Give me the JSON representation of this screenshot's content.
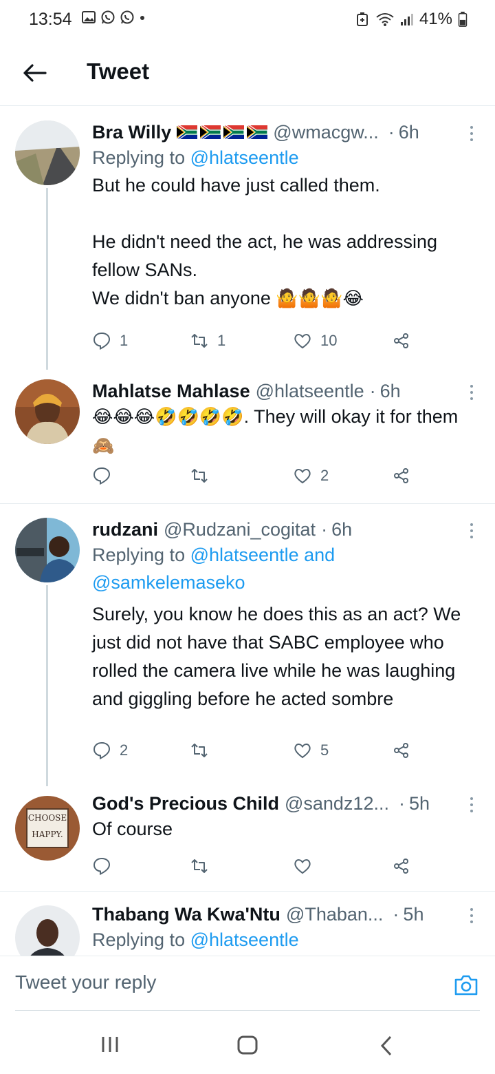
{
  "status_bar": {
    "time": "13:54",
    "battery": "41%",
    "notification_icons": [
      "gallery-icon",
      "whatsapp-icon",
      "whatsapp-icon",
      "dot-icon"
    ],
    "right_icons": [
      "battery-saver-icon",
      "wifi-icon",
      "signal-icon",
      "battery-icon"
    ]
  },
  "header": {
    "title": "Tweet"
  },
  "tweets": [
    {
      "name": "Bra Willy",
      "handle": "@wmacgw...",
      "dot": "·",
      "time": "6h",
      "replying_prefix": "Replying to ",
      "replying_to": "@hlatseentle",
      "text_main": "But he could have just called them.\n\nHe didn't need the act, he was addressing fellow SANs.\nWe didn't ban anyone ",
      "text_emoji": "🤷🤷🤷😂",
      "replies": "1",
      "retweets": "1",
      "likes": "10"
    },
    {
      "name": "Mahlatse Mahlase",
      "handle": "@hlatseentle",
      "dot": "·",
      "time": "6h",
      "text_emoji": "😂😂😂🤣🤣🤣🤣",
      "text_main": ". They will okay it for them ",
      "text_emoji2": "🙈",
      "replies": "",
      "retweets": "",
      "likes": "2"
    },
    {
      "name": "rudzani",
      "handle": "@Rudzani_cogitat",
      "dot": "·",
      "time": "6h",
      "replying_prefix": "Replying to ",
      "replying_to": "@hlatseentle",
      "replying_and": " and",
      "replying_to2": "@samkelemaseko",
      "text_main": "Surely, you know he does this as an act? We just did not have that SABC employee who rolled the camera live while he was laughing and giggling before he acted sombre",
      "replies": "2",
      "retweets": "",
      "likes": "5"
    },
    {
      "name": "God's Precious Child",
      "handle": "@sandz12...",
      "dot": "·",
      "time": "5h",
      "text_main": "Of course",
      "avatar_text_1": "CHOOSE",
      "avatar_text_2": "HAPPY.",
      "replies": "",
      "retweets": "",
      "likes": ""
    },
    {
      "name": "Thabang Wa Kwa'Ntu",
      "handle": "@Thaban...",
      "dot": "·",
      "time": "5h",
      "replying_prefix": "Replying to ",
      "replying_to": "@hlatseentle"
    }
  ],
  "reply_bar": {
    "placeholder": "Tweet your reply"
  },
  "colors": {
    "accent": "#1d9bf0",
    "text": "#0f1419",
    "muted": "#536471",
    "divider": "#e6ecf0"
  }
}
